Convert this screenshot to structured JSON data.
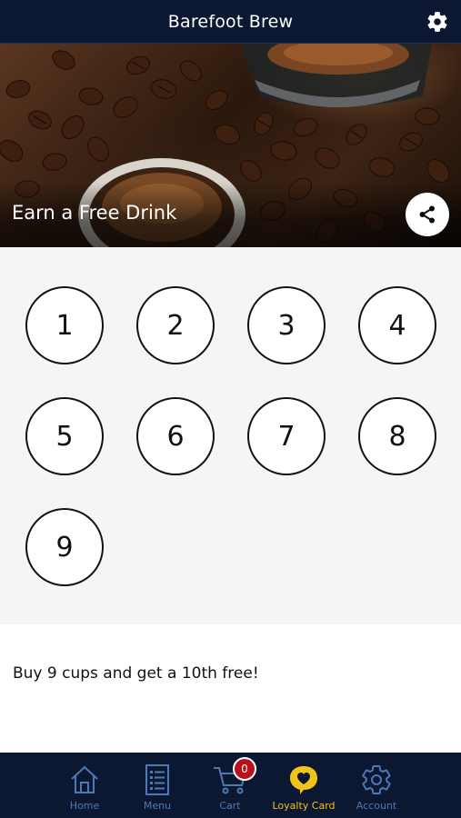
{
  "app": {
    "title": "Barefoot Brew"
  },
  "hero": {
    "caption": "Earn a Free Drink"
  },
  "stamps": [
    "1",
    "2",
    "3",
    "4",
    "5",
    "6",
    "7",
    "8",
    "9"
  ],
  "description": "Buy 9 cups and get a 10th free!",
  "nav": {
    "home": "Home",
    "menu": "Menu",
    "cart": "Cart",
    "cart_count": "0",
    "loyalty": "Loyalty Card",
    "account": "Account"
  },
  "colors": {
    "header_bg": "#0c1731",
    "nav_inactive": "#4f79b6",
    "nav_active": "#f2c31a",
    "badge": "#b5121b",
    "stamp_area_bg": "#f5f5f5"
  },
  "icons": {
    "settings": "gear-icon",
    "share": "share-icon",
    "home": "home-icon",
    "menu": "menu-list-icon",
    "cart": "cart-icon",
    "loyalty": "heart-badge-icon",
    "account": "gear-icon"
  }
}
